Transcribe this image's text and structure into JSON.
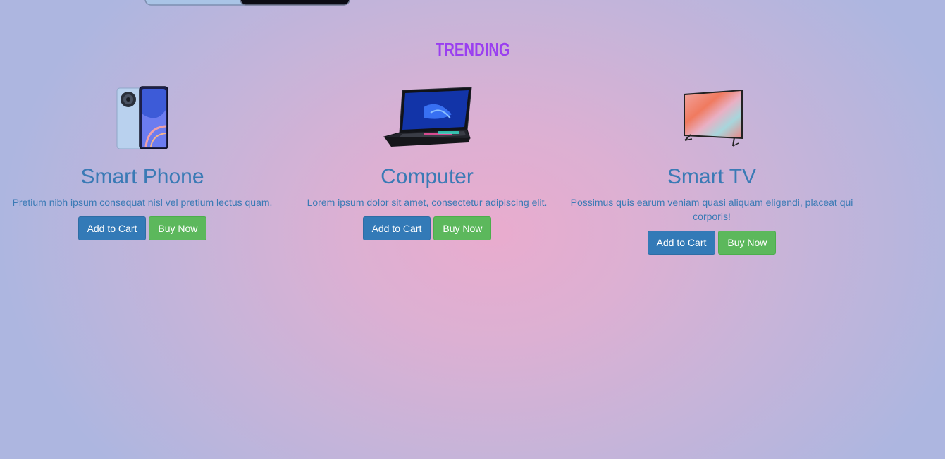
{
  "section_heading": "TRENDING",
  "colors": {
    "heading": "#9a3ff0",
    "title_text": "#3a7ab5",
    "add_to_cart_button": "#337ab7",
    "buy_now_button": "#5cb85c"
  },
  "products": [
    {
      "title": "Smart Phone",
      "description": "Pretium nibh ipsum consequat nisl vel pretium lectus quam.",
      "add_to_cart_label": "Add to Cart",
      "buy_now_label": "Buy Now",
      "image": "smartphone-image"
    },
    {
      "title": "Computer",
      "description": "Lorem ipsum dolor sit amet, consectetur adipiscing elit.",
      "add_to_cart_label": "Add to Cart",
      "buy_now_label": "Buy Now",
      "image": "laptop-image"
    },
    {
      "title": "Smart TV",
      "description": "Possimus quis earum veniam quasi aliquam eligendi, placeat qui corporis!",
      "add_to_cart_label": "Add to Cart",
      "buy_now_label": "Buy Now",
      "image": "television-image"
    }
  ]
}
